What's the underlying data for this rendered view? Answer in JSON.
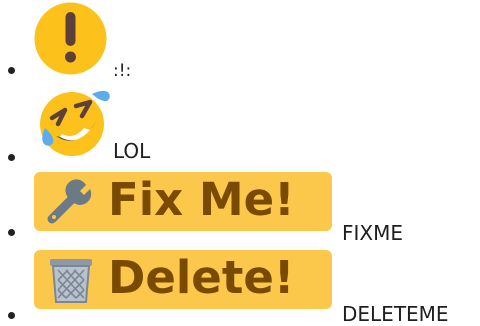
{
  "items": [
    {
      "icon": "exclamation-emoji-icon",
      "label": ":!:"
    },
    {
      "icon": "rolling-on-floor-laughing-emoji-icon",
      "label": "LOL"
    },
    {
      "icon": "fix-me-badge-icon",
      "badge_text": "Fix Me!",
      "label": "FIXME"
    },
    {
      "icon": "delete-badge-icon",
      "badge_text": "Delete!",
      "label": "DELETEME"
    }
  ],
  "colors": {
    "emoji_yellow": "#fcc21b",
    "emoji_dark": "#5d4037",
    "tear_blue": "#5dadec",
    "badge_background": "#fbc84c",
    "badge_text": "#7a4a00"
  }
}
